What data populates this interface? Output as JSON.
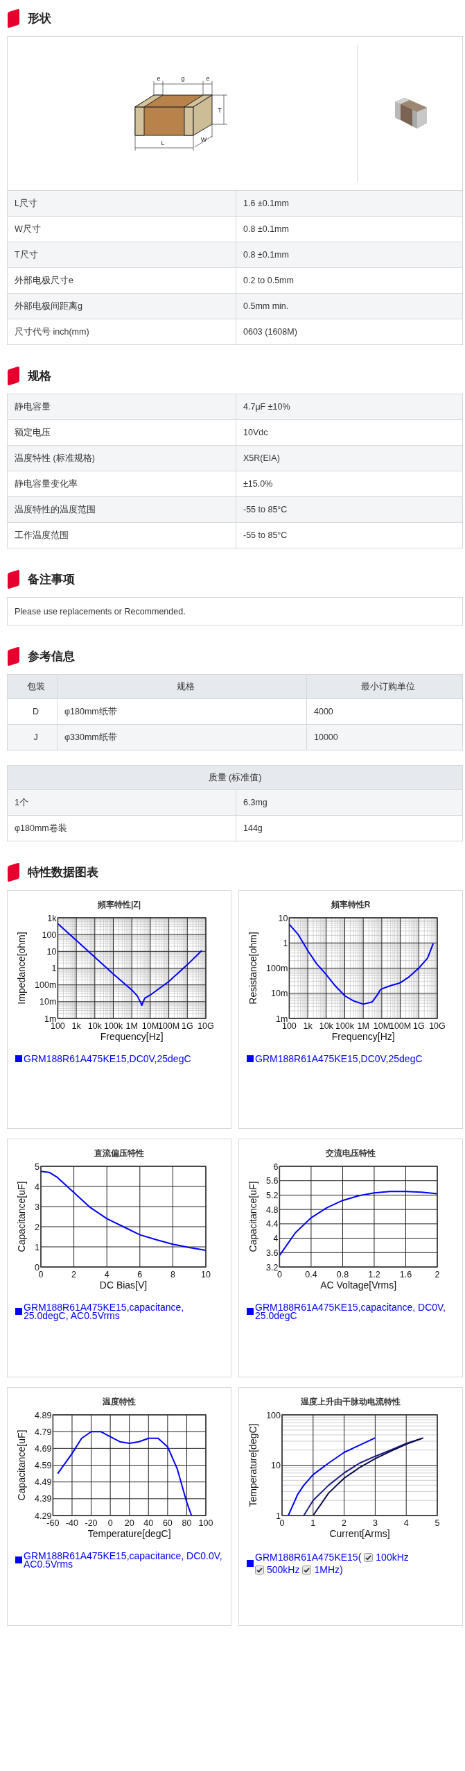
{
  "sections": [
    {
      "kind": "shape",
      "title": "形状",
      "diagram_labels": [
        "e",
        "g",
        "e",
        "T",
        "W",
        "L"
      ],
      "photo": {
        "kind": "picture"
      },
      "rows": [
        {
          "label": "L尺寸",
          "value": "1.6 ±0.1mm"
        },
        {
          "label": "W尺寸",
          "value": "0.8 ±0.1mm"
        },
        {
          "label": "T尺寸",
          "value": "0.8 ±0.1mm"
        },
        {
          "label": "外部电极尺寸e",
          "value": "0.2 to 0.5mm"
        },
        {
          "label": "外部电极间距离g",
          "value": "0.5mm min."
        },
        {
          "label": "尺寸代号 inch(mm)",
          "value": "0603 (1608M)"
        }
      ]
    },
    {
      "kind": "specs",
      "title": "规格",
      "rows": [
        {
          "label": "静电容量",
          "value": "4.7μF ±10%"
        },
        {
          "label": "额定电压",
          "value": "10Vdc"
        },
        {
          "label": "温度特性 (标准规格)",
          "value": "X5R(EIA)"
        },
        {
          "label": "静电容量变化率",
          "value": "±15.0%"
        },
        {
          "label": "温度特性的温度范围",
          "value": "-55 to 85°C"
        },
        {
          "label": "工作温度范围",
          "value": "-55 to 85°C"
        }
      ]
    },
    {
      "kind": "note",
      "title": "备注事项",
      "text": "Please use replacements or Recommended."
    },
    {
      "kind": "reference",
      "title": "参考信息",
      "packaging": {
        "columns": [
          "包装",
          "规格",
          "最小订购单位"
        ],
        "rows": [
          [
            "D",
            "φ180mm纸带",
            "4000"
          ],
          [
            "J",
            "φ330mm纸带",
            "10000"
          ]
        ]
      },
      "mass": {
        "title": "质量 (标准值)",
        "rows": [
          {
            "label": "1个",
            "value": "6.3mg"
          },
          {
            "label": "φ180mm卷装",
            "value": "144g"
          }
        ]
      }
    },
    {
      "kind": "charts",
      "title": "特性数据图表",
      "charts": [
        {
          "kind": "log_log",
          "title": "頻率特性|Z|",
          "xlabel": "Frequency[Hz]",
          "ylabel": "Impedance[ohm]",
          "x_tick_labels": [
            "100",
            "1k",
            "10k",
            "100k",
            "1M",
            "10M",
            "100M",
            "1G",
            "10G"
          ],
          "y_tick_labels": [
            "1k",
            "100",
            "10",
            "1",
            "100m",
            "10m",
            "1m"
          ],
          "legend": "GRM188R61A475KE15,DC0V,25degC"
        },
        {
          "kind": "log_log",
          "title": "頻率特性R",
          "xlabel": "Frequency[Hz]",
          "ylabel": "Resistance[ohm]",
          "x_tick_labels": [
            "100",
            "1k",
            "10k",
            "100k",
            "1M",
            "10M",
            "100M",
            "1G",
            "10G"
          ],
          "y_tick_labels": [
            "10",
            "1",
            "100m",
            "10m",
            "1m"
          ],
          "legend": "GRM188R61A475KE15,DC0V,25degC"
        },
        {
          "kind": "plot",
          "chart_data": {
            "type": "line",
            "title": "直流偏压特性",
            "xlabel": "DC Bias[V]",
            "ylabel": "Capacitance[uF]",
            "x": [
              0,
              0.5,
              1,
              2,
              3,
              4,
              5,
              6,
              7,
              8,
              9,
              10
            ],
            "series": [
              {
                "name": "GRM188R61A475KE15,capacitance, 25.0degC, AC0.5Vrms",
                "color": "#0000ff",
                "values": [
                  4.75,
                  4.7,
                  4.45,
                  3.7,
                  2.95,
                  2.4,
                  2.0,
                  1.6,
                  1.35,
                  1.13,
                  0.97,
                  0.83
                ]
              }
            ],
            "xlim": [
              0,
              10
            ],
            "ylim": [
              0,
              5
            ],
            "grid": true,
            "xticks": [
              0,
              2,
              4,
              6,
              8,
              10
            ],
            "yticks": [
              0,
              1,
              2,
              3,
              4,
              5
            ]
          }
        },
        {
          "kind": "plot",
          "chart_data": {
            "type": "line",
            "title": "交流电压特性",
            "xlabel": "AC Voltage[Vrms]",
            "ylabel": "Capacitance[uF]",
            "x": [
              0,
              0.2,
              0.4,
              0.6,
              0.8,
              1,
              1.2,
              1.4,
              1.6,
              1.8,
              2
            ],
            "series": [
              {
                "name": "GRM188R61A475KE15,capacitance, DC0V, 25.0degC",
                "color": "#0000ff",
                "values": [
                  3.52,
                  4.15,
                  4.57,
                  4.85,
                  5.05,
                  5.18,
                  5.26,
                  5.3,
                  5.3,
                  5.28,
                  5.24
                ]
              }
            ],
            "xlim": [
              0,
              2
            ],
            "ylim": [
              3.2,
              6
            ],
            "grid": true,
            "xticks": [
              0,
              0.4,
              0.8,
              1.2,
              1.6,
              2
            ],
            "yticks": [
              3.2,
              3.6,
              4,
              4.4,
              4.8,
              5.2,
              5.6,
              6
            ]
          }
        },
        {
          "kind": "plot",
          "chart_data": {
            "type": "line",
            "title": "温度特性",
            "xlabel": "Temperature[degC]",
            "ylabel": "Capacitance[uF]",
            "x": [
              -55,
              -40,
              -30,
              -20,
              -10,
              0,
              10,
              20,
              30,
              40,
              50,
              60,
              70,
              80,
              85
            ],
            "series": [
              {
                "name": "GRM188R61A475KE15,capacitance, DC0.0V, AC0.5Vrms",
                "color": "#0000ff",
                "values": [
                  4.54,
                  4.66,
                  4.75,
                  4.79,
                  4.79,
                  4.76,
                  4.73,
                  4.72,
                  4.73,
                  4.75,
                  4.75,
                  4.7,
                  4.57,
                  4.37,
                  4.29
                ]
              }
            ],
            "xlim": [
              -60,
              100
            ],
            "ylim": [
              4.29,
              4.89
            ],
            "grid": true,
            "xticks": [
              -60,
              -40,
              -20,
              0,
              20,
              40,
              60,
              80,
              100
            ],
            "yticks": [
              4.29,
              4.39,
              4.49,
              4.59,
              4.69,
              4.79,
              4.89
            ]
          }
        },
        {
          "kind": "lin_log",
          "title": "温度上升由干脉动电流特性",
          "xlabel": "Current[Arms]",
          "ylabel": "Temperature[degC]",
          "x_tick_labels": [
            "0",
            "1",
            "2",
            "3",
            "4",
            "5"
          ],
          "y_tick_labels": [
            "100",
            "10",
            "1"
          ],
          "legend_prefix": "GRM188R61A475KE15(",
          "legend_options": [
            {
              "label": "100kHz",
              "checked": true
            },
            {
              "label": "500kHz",
              "checked": true
            },
            {
              "label": "1MHz",
              "checked": true
            }
          ],
          "legend_suffix": ")"
        }
      ]
    }
  ]
}
